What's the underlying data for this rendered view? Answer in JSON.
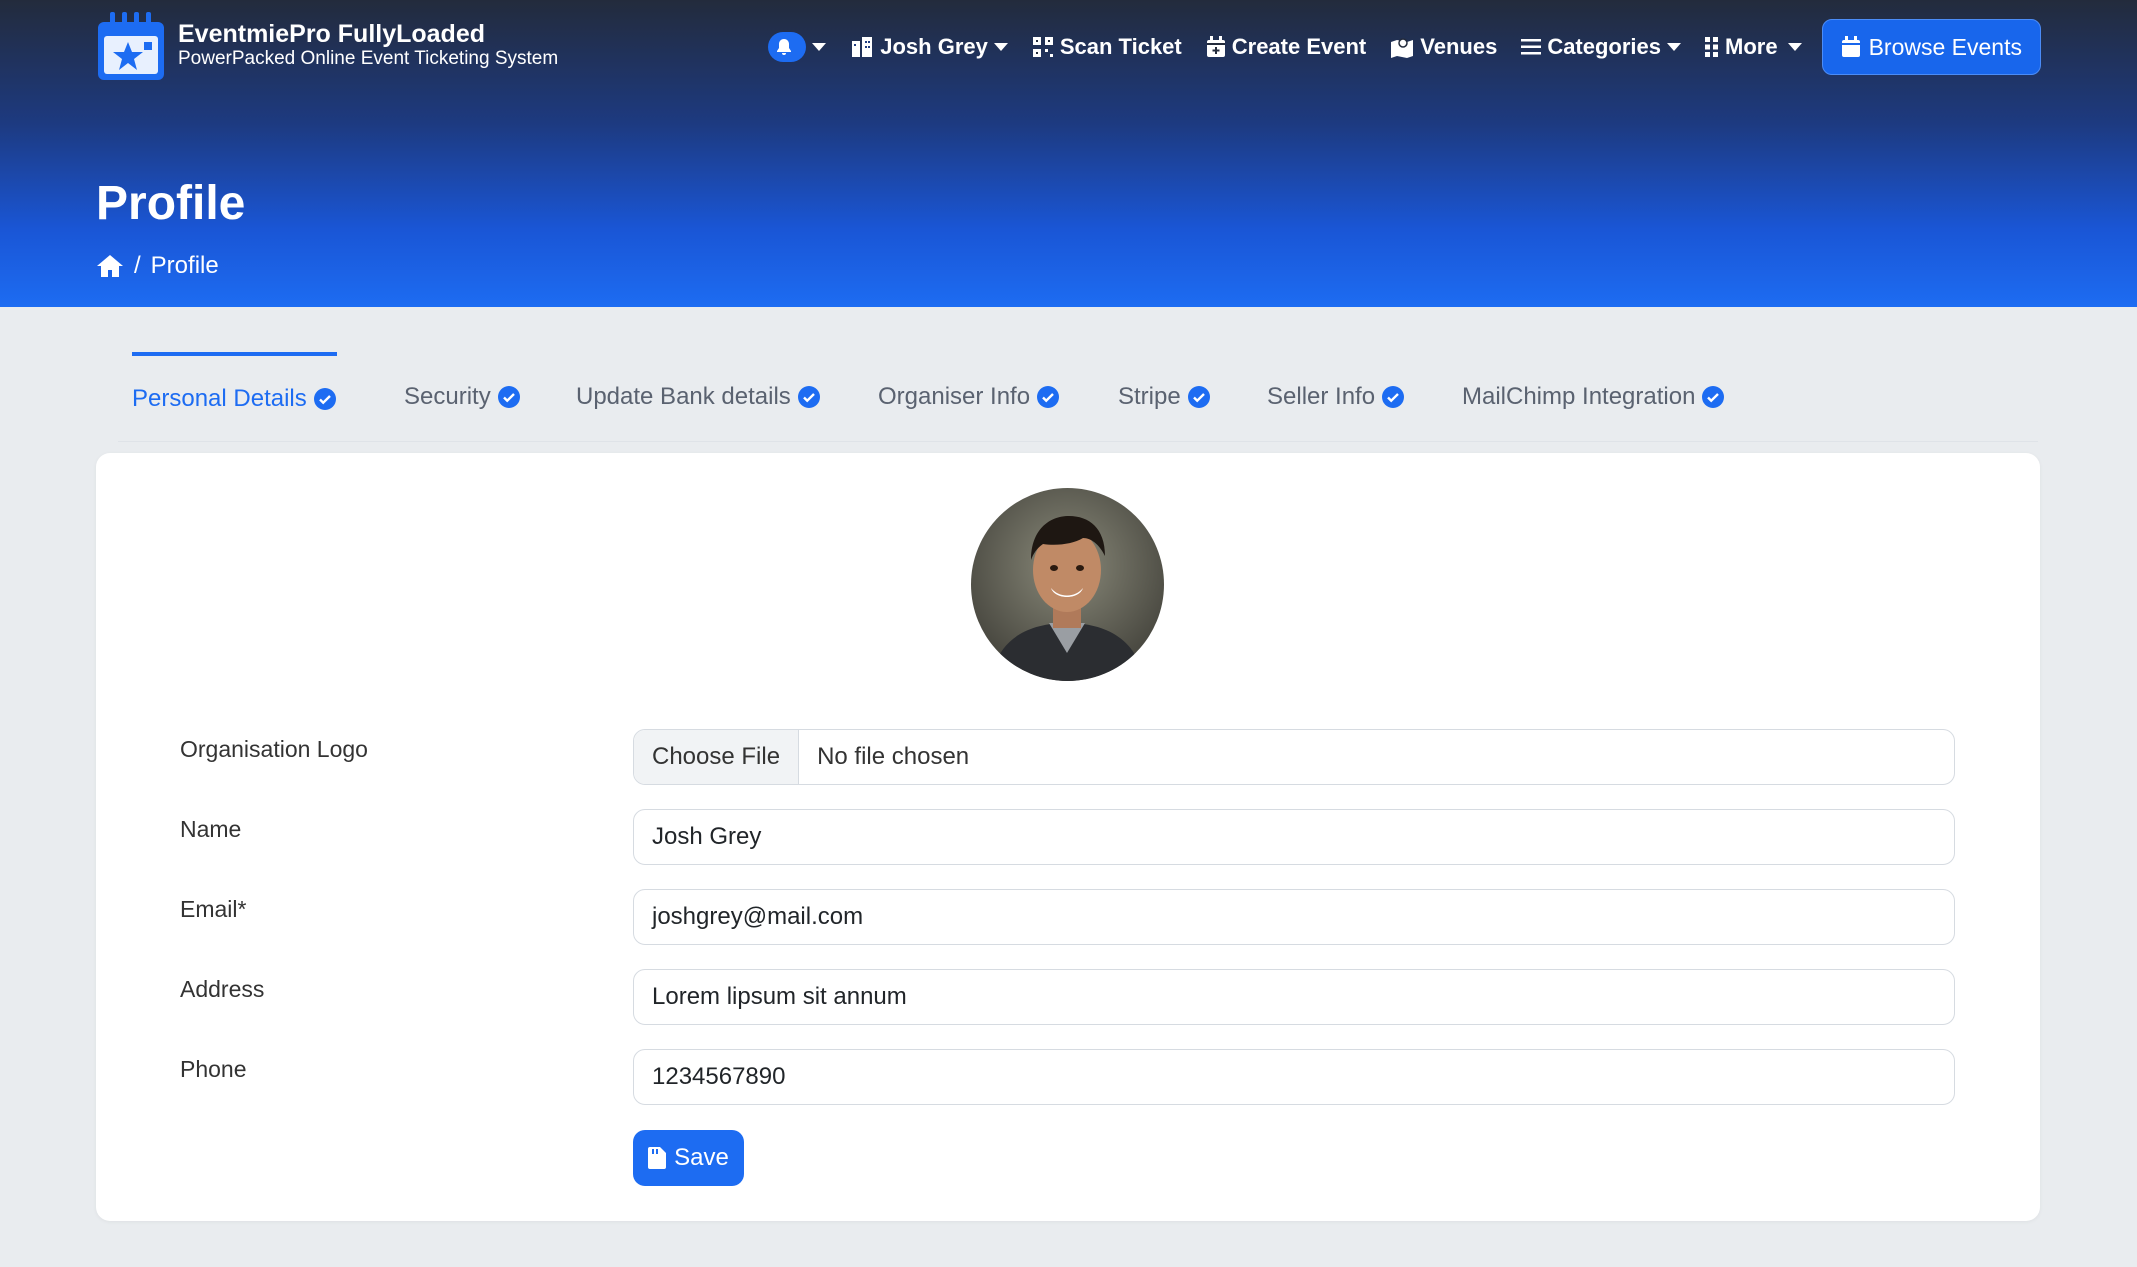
{
  "brand": {
    "title": "EventmiePro FullyLoaded",
    "subtitle": "PowerPacked Online Event Ticketing System",
    "logo_icon": "calendar-star-icon"
  },
  "nav": {
    "user_name": "Josh Grey",
    "scan_ticket": "Scan Ticket",
    "create_event": "Create Event",
    "venues": "Venues",
    "categories": "Categories",
    "more": "More",
    "browse_events": "Browse Events"
  },
  "page": {
    "title": "Profile",
    "breadcrumb_current": "Profile"
  },
  "tabs": [
    {
      "label": "Personal Details",
      "active": true
    },
    {
      "label": "Security"
    },
    {
      "label": "Update Bank details"
    },
    {
      "label": "Organiser Info"
    },
    {
      "label": "Stripe"
    },
    {
      "label": "Seller Info"
    },
    {
      "label": "MailChimp Integration"
    }
  ],
  "form": {
    "logo_label": "Organisation Logo",
    "file_button": "Choose File",
    "file_status": "No file chosen",
    "name_label": "Name",
    "name_value": "Josh Grey",
    "email_label": "Email*",
    "email_value": "joshgrey@mail.com",
    "address_label": "Address",
    "address_value": "Lorem lipsum sit annum",
    "phone_label": "Phone",
    "phone_value": "1234567890",
    "save_label": "Save"
  },
  "colors": {
    "accent": "#1d6cf2",
    "header_dark": "#232b3c",
    "page_bg": "#e9ecef"
  }
}
